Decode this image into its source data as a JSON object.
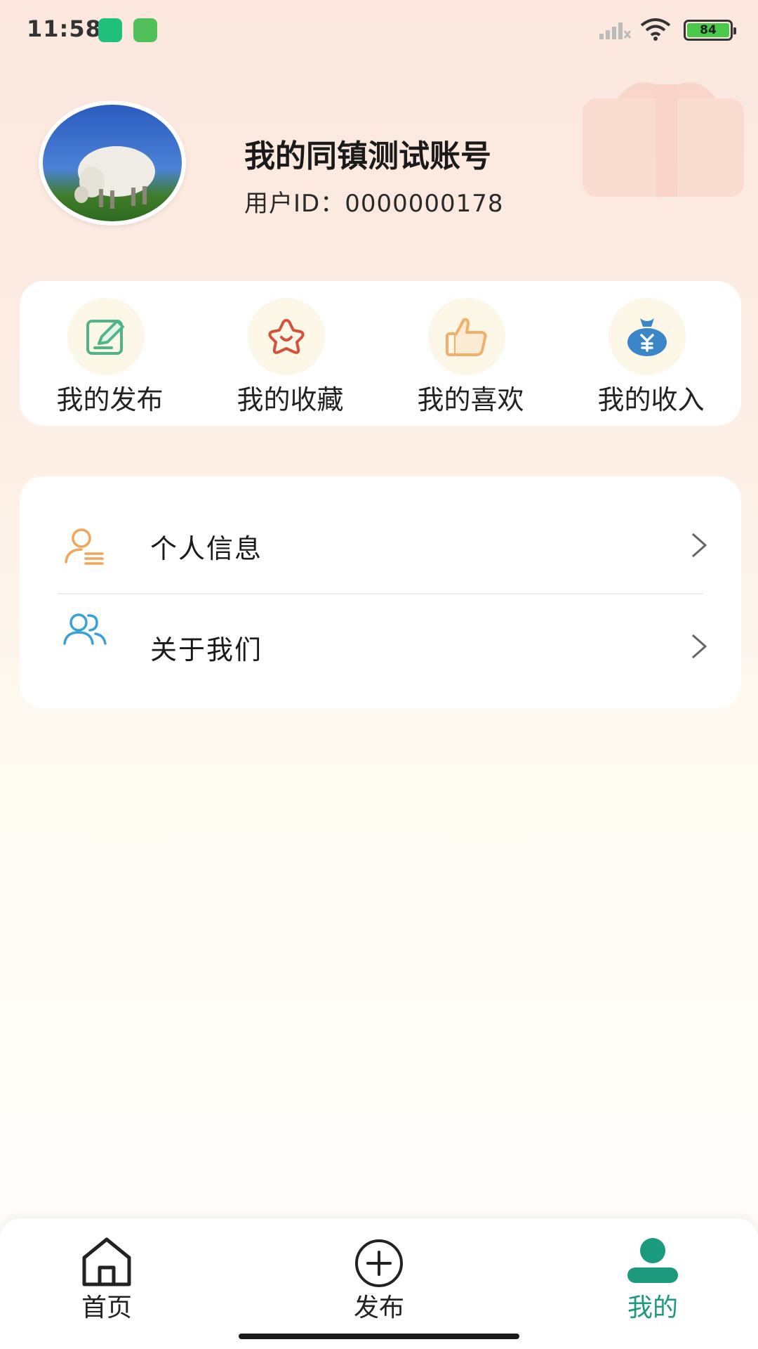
{
  "status_bar": {
    "time": "11:58",
    "battery": "84"
  },
  "profile": {
    "name": "我的同镇测试账号",
    "user_id": "用户ID：0000000178"
  },
  "quick_actions": [
    {
      "label": "我的发布",
      "icon": "edit-icon"
    },
    {
      "label": "我的收藏",
      "icon": "star-icon"
    },
    {
      "label": "我的喜欢",
      "icon": "thumbs-up-icon"
    },
    {
      "label": "我的收入",
      "icon": "money-bag-icon"
    }
  ],
  "menu": [
    {
      "label": "个人信息",
      "icon": "person-info-icon"
    },
    {
      "label": "关于我们",
      "icon": "users-icon"
    }
  ],
  "bottom_nav": [
    {
      "label": "首页",
      "icon": "home-icon",
      "active": false
    },
    {
      "label": "发布",
      "icon": "plus-circle-icon",
      "active": false
    },
    {
      "label": "我的",
      "icon": "user-icon",
      "active": true
    }
  ],
  "colors": {
    "accent": "#1b9a7e",
    "edit": "#4fb487",
    "star": "#d2533a",
    "thumb": "#f0b06a",
    "money": "#3a86c8",
    "person_info": "#f0a65a",
    "users": "#3aa0d8"
  }
}
